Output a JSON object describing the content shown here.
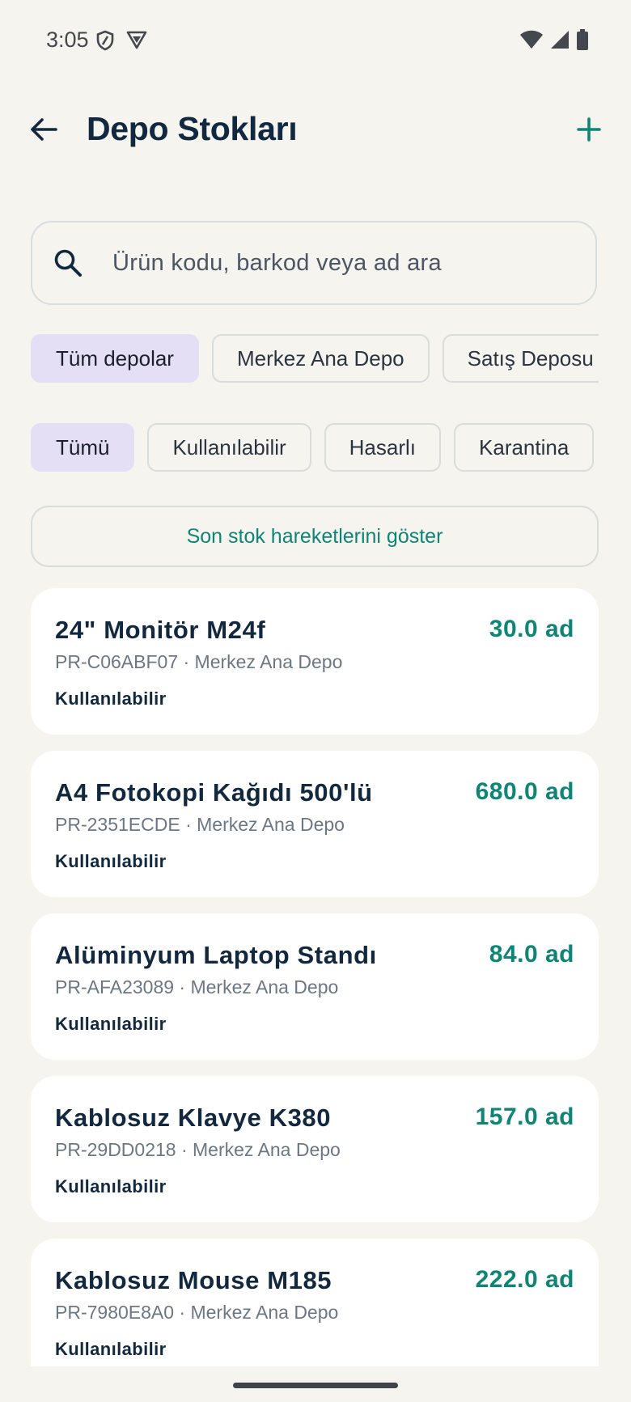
{
  "status_bar": {
    "time": "3:05"
  },
  "header": {
    "title": "Depo Stokları"
  },
  "search": {
    "placeholder": "Ürün kodu, barkod veya ad ara"
  },
  "warehouse_filters": [
    {
      "label": "Tüm depolar",
      "selected": true
    },
    {
      "label": "Merkez Ana Depo",
      "selected": false
    },
    {
      "label": "Satış Deposu",
      "selected": false
    }
  ],
  "status_filters": [
    {
      "label": "Tümü",
      "selected": true
    },
    {
      "label": "Kullanılabilir",
      "selected": false
    },
    {
      "label": "Hasarlı",
      "selected": false
    },
    {
      "label": "Karantina",
      "selected": false
    }
  ],
  "history_button": {
    "label": "Son stok hareketlerini göster"
  },
  "items": [
    {
      "name": "24\" Monitör M24f",
      "quantity": "30.0 ad",
      "subtitle": "PR-C06ABF07 · Merkez Ana Depo",
      "status": "Kullanılabilir"
    },
    {
      "name": "A4 Fotokopi Kağıdı 500'lü",
      "quantity": "680.0 ad",
      "subtitle": "PR-2351ECDE · Merkez Ana Depo",
      "status": "Kullanılabilir"
    },
    {
      "name": "Alüminyum Laptop Standı",
      "quantity": "84.0 ad",
      "subtitle": "PR-AFA23089 · Merkez Ana Depo",
      "status": "Kullanılabilir"
    },
    {
      "name": "Kablosuz Klavye K380",
      "quantity": "157.0 ad",
      "subtitle": "PR-29DD0218 · Merkez Ana Depo",
      "status": "Kullanılabilir"
    },
    {
      "name": "Kablosuz Mouse M185",
      "quantity": "222.0 ad",
      "subtitle": "PR-7980E8A0 · Merkez Ana Depo",
      "status": "Kullanılabilir"
    }
  ],
  "colors": {
    "accent": "#0f8576",
    "selected_chip": "#e4dff5",
    "background": "#f5f4ef",
    "title": "#12283f"
  },
  "icons": [
    "shield-icon",
    "vpn-icon",
    "wifi-icon",
    "signal-icon",
    "battery-icon",
    "back-arrow-icon",
    "add-icon",
    "search-icon"
  ]
}
